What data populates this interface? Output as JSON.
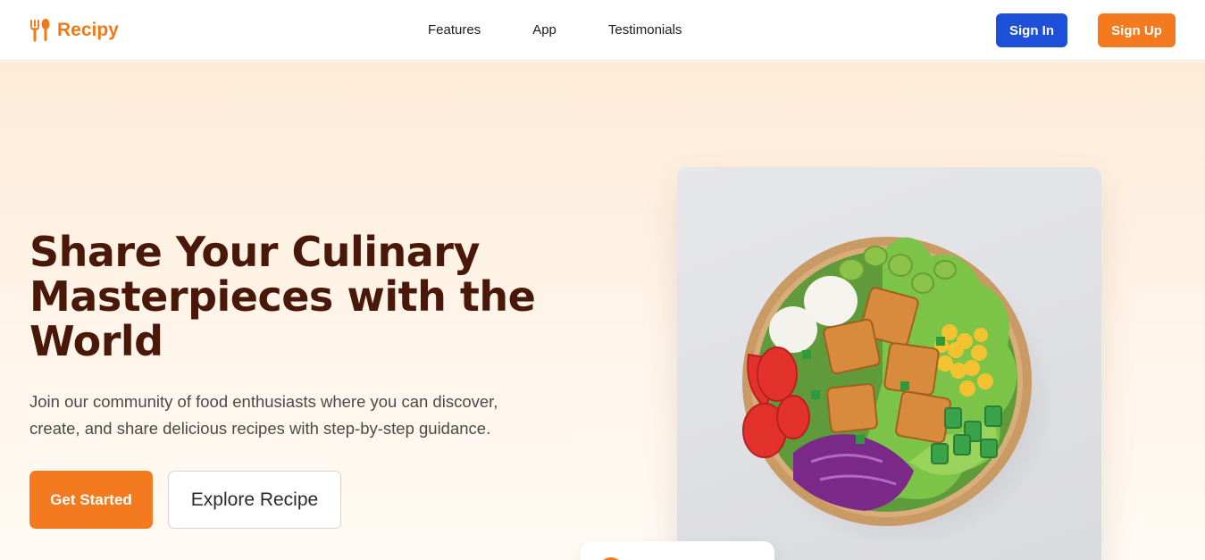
{
  "brand": {
    "name": "Recipy"
  },
  "nav": {
    "links": [
      "Features",
      "App",
      "Testimonials"
    ]
  },
  "auth": {
    "sign_in": "Sign In",
    "sign_up": "Sign Up"
  },
  "hero": {
    "title": "Share Your Culinary Masterpieces with the World",
    "subtitle": "Join our community of food enthusiasts where you can discover, create, and share delicious recipes with step-by-step guidance.",
    "cta_primary": "Get Started",
    "cta_secondary": "Explore Recipe"
  },
  "colors": {
    "brand_orange": "#f47a1f",
    "sign_in_blue": "#1d4fd8",
    "title_brown": "#4a1809"
  },
  "icons": {
    "logo": "fork-spoon-icon"
  }
}
